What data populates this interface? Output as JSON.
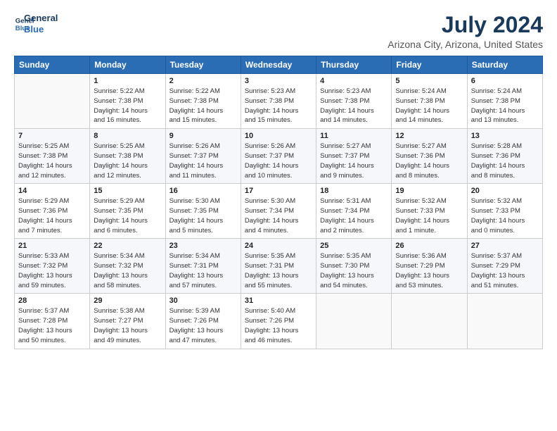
{
  "logo": {
    "line1": "General",
    "line2": "Blue"
  },
  "title": "July 2024",
  "subtitle": "Arizona City, Arizona, United States",
  "days_header": [
    "Sunday",
    "Monday",
    "Tuesday",
    "Wednesday",
    "Thursday",
    "Friday",
    "Saturday"
  ],
  "weeks": [
    [
      {
        "num": "",
        "info": ""
      },
      {
        "num": "1",
        "info": "Sunrise: 5:22 AM\nSunset: 7:38 PM\nDaylight: 14 hours\nand 16 minutes."
      },
      {
        "num": "2",
        "info": "Sunrise: 5:22 AM\nSunset: 7:38 PM\nDaylight: 14 hours\nand 15 minutes."
      },
      {
        "num": "3",
        "info": "Sunrise: 5:23 AM\nSunset: 7:38 PM\nDaylight: 14 hours\nand 15 minutes."
      },
      {
        "num": "4",
        "info": "Sunrise: 5:23 AM\nSunset: 7:38 PM\nDaylight: 14 hours\nand 14 minutes."
      },
      {
        "num": "5",
        "info": "Sunrise: 5:24 AM\nSunset: 7:38 PM\nDaylight: 14 hours\nand 14 minutes."
      },
      {
        "num": "6",
        "info": "Sunrise: 5:24 AM\nSunset: 7:38 PM\nDaylight: 14 hours\nand 13 minutes."
      }
    ],
    [
      {
        "num": "7",
        "info": "Sunrise: 5:25 AM\nSunset: 7:38 PM\nDaylight: 14 hours\nand 12 minutes."
      },
      {
        "num": "8",
        "info": "Sunrise: 5:25 AM\nSunset: 7:38 PM\nDaylight: 14 hours\nand 12 minutes."
      },
      {
        "num": "9",
        "info": "Sunrise: 5:26 AM\nSunset: 7:37 PM\nDaylight: 14 hours\nand 11 minutes."
      },
      {
        "num": "10",
        "info": "Sunrise: 5:26 AM\nSunset: 7:37 PM\nDaylight: 14 hours\nand 10 minutes."
      },
      {
        "num": "11",
        "info": "Sunrise: 5:27 AM\nSunset: 7:37 PM\nDaylight: 14 hours\nand 9 minutes."
      },
      {
        "num": "12",
        "info": "Sunrise: 5:27 AM\nSunset: 7:36 PM\nDaylight: 14 hours\nand 8 minutes."
      },
      {
        "num": "13",
        "info": "Sunrise: 5:28 AM\nSunset: 7:36 PM\nDaylight: 14 hours\nand 8 minutes."
      }
    ],
    [
      {
        "num": "14",
        "info": "Sunrise: 5:29 AM\nSunset: 7:36 PM\nDaylight: 14 hours\nand 7 minutes."
      },
      {
        "num": "15",
        "info": "Sunrise: 5:29 AM\nSunset: 7:35 PM\nDaylight: 14 hours\nand 6 minutes."
      },
      {
        "num": "16",
        "info": "Sunrise: 5:30 AM\nSunset: 7:35 PM\nDaylight: 14 hours\nand 5 minutes."
      },
      {
        "num": "17",
        "info": "Sunrise: 5:30 AM\nSunset: 7:34 PM\nDaylight: 14 hours\nand 4 minutes."
      },
      {
        "num": "18",
        "info": "Sunrise: 5:31 AM\nSunset: 7:34 PM\nDaylight: 14 hours\nand 2 minutes."
      },
      {
        "num": "19",
        "info": "Sunrise: 5:32 AM\nSunset: 7:33 PM\nDaylight: 14 hours\nand 1 minute."
      },
      {
        "num": "20",
        "info": "Sunrise: 5:32 AM\nSunset: 7:33 PM\nDaylight: 14 hours\nand 0 minutes."
      }
    ],
    [
      {
        "num": "21",
        "info": "Sunrise: 5:33 AM\nSunset: 7:32 PM\nDaylight: 13 hours\nand 59 minutes."
      },
      {
        "num": "22",
        "info": "Sunrise: 5:34 AM\nSunset: 7:32 PM\nDaylight: 13 hours\nand 58 minutes."
      },
      {
        "num": "23",
        "info": "Sunrise: 5:34 AM\nSunset: 7:31 PM\nDaylight: 13 hours\nand 57 minutes."
      },
      {
        "num": "24",
        "info": "Sunrise: 5:35 AM\nSunset: 7:31 PM\nDaylight: 13 hours\nand 55 minutes."
      },
      {
        "num": "25",
        "info": "Sunrise: 5:35 AM\nSunset: 7:30 PM\nDaylight: 13 hours\nand 54 minutes."
      },
      {
        "num": "26",
        "info": "Sunrise: 5:36 AM\nSunset: 7:29 PM\nDaylight: 13 hours\nand 53 minutes."
      },
      {
        "num": "27",
        "info": "Sunrise: 5:37 AM\nSunset: 7:29 PM\nDaylight: 13 hours\nand 51 minutes."
      }
    ],
    [
      {
        "num": "28",
        "info": "Sunrise: 5:37 AM\nSunset: 7:28 PM\nDaylight: 13 hours\nand 50 minutes."
      },
      {
        "num": "29",
        "info": "Sunrise: 5:38 AM\nSunset: 7:27 PM\nDaylight: 13 hours\nand 49 minutes."
      },
      {
        "num": "30",
        "info": "Sunrise: 5:39 AM\nSunset: 7:26 PM\nDaylight: 13 hours\nand 47 minutes."
      },
      {
        "num": "31",
        "info": "Sunrise: 5:40 AM\nSunset: 7:26 PM\nDaylight: 13 hours\nand 46 minutes."
      },
      {
        "num": "",
        "info": ""
      },
      {
        "num": "",
        "info": ""
      },
      {
        "num": "",
        "info": ""
      }
    ]
  ]
}
